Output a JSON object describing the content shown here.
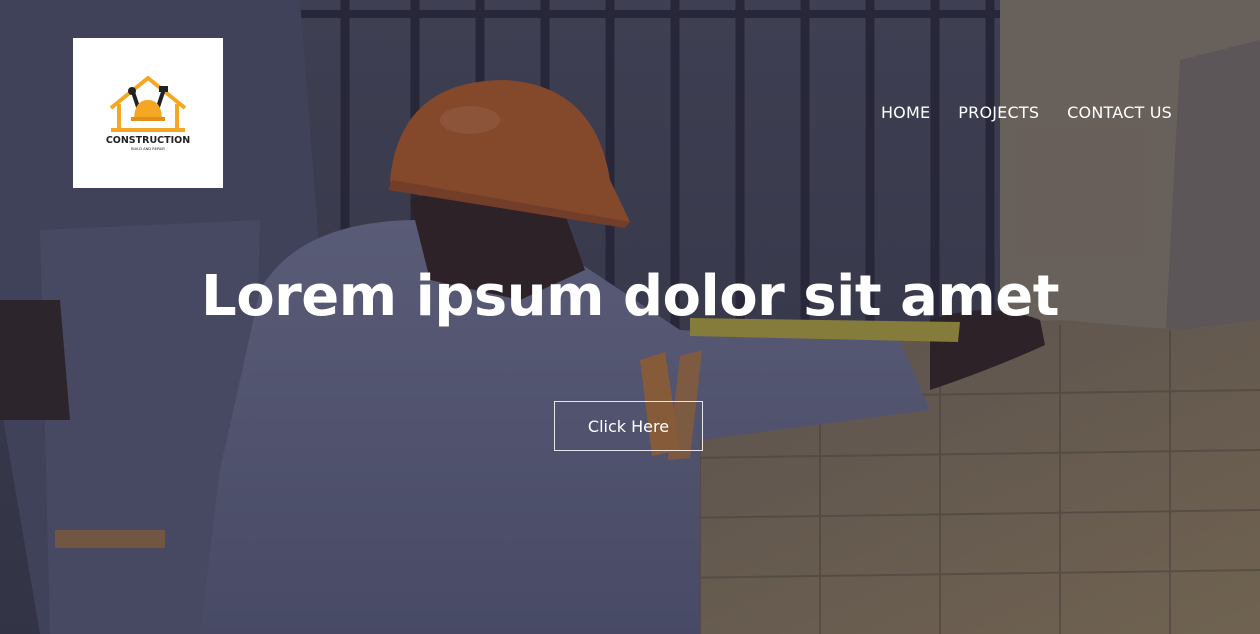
{
  "logo": {
    "title": "CONSTRUCTION",
    "subtitle": "BUILD AND REPAIR",
    "accent_color": "#f5a623",
    "icon": "house-helmet-tools-icon"
  },
  "nav": {
    "items": [
      {
        "label": "HOME"
      },
      {
        "label": "PROJECTS"
      },
      {
        "label": "CONTACT US"
      }
    ]
  },
  "hero": {
    "headline": "Lorem ipsum dolor sit amet",
    "cta_label": "Click Here",
    "background": "construction-worker-measuring-brick-wall-photo"
  }
}
